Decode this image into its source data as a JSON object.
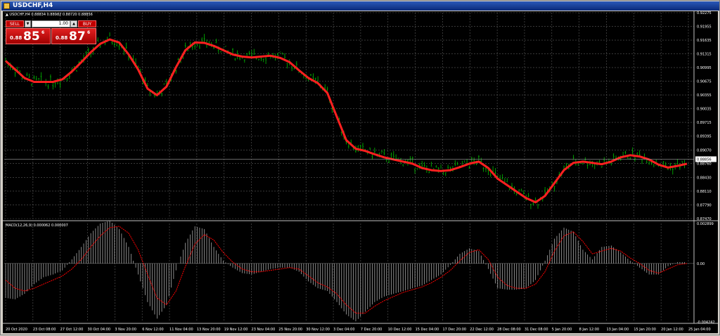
{
  "window": {
    "title": "USDCHF,H4"
  },
  "chart_header": {
    "text": "▲ USDCHF,H4  0.88834 0.88982 0.88720 0.88856"
  },
  "trade_panel": {
    "sell_label": "SELL",
    "buy_label": "BUY",
    "lot_value": "1.00",
    "sell_small": "0.88",
    "sell_big": "85",
    "sell_sup": "6",
    "buy_small": "0.88",
    "buy_big": "87",
    "buy_sup": "6"
  },
  "colors": {
    "background": "#000000",
    "grid": "#5a5a5a",
    "candles": "#00c000",
    "moving_average": "#ff2020",
    "histogram": "#c0c0c0",
    "signal": "#ff0000",
    "axis_text": "#ffffff",
    "trade_button": "#c00000"
  },
  "macd_header": {
    "text": "MACD(12,26,9) 0.000062 0.000007"
  },
  "chart_data": [
    {
      "type": "candlestick",
      "symbol": "USDCHF",
      "timeframe": "H4",
      "y_ticks": [
        "0.92275",
        "0.91955",
        "0.91635",
        "0.91315",
        "0.90995",
        "0.90675",
        "0.90355",
        "0.90035",
        "0.89715",
        "0.89395",
        "0.89070",
        "0.88760",
        "0.88430",
        "0.88110",
        "0.87790",
        "0.87470"
      ],
      "ylim": [
        0.8747,
        0.92275
      ],
      "current_price_label": "0.88856",
      "current_price": 0.88856,
      "moving_average_close": [
        0.9115,
        0.9095,
        0.9075,
        0.9066,
        0.9066,
        0.9066,
        0.9072,
        0.909,
        0.9112,
        0.9135,
        0.9155,
        0.9165,
        0.9158,
        0.913,
        0.9095,
        0.905,
        0.9035,
        0.9055,
        0.91,
        0.914,
        0.9158,
        0.9157,
        0.915,
        0.914,
        0.913,
        0.9125,
        0.9123,
        0.9125,
        0.9127,
        0.9122,
        0.9112,
        0.9093,
        0.9075,
        0.9063,
        0.904,
        0.8985,
        0.893,
        0.891,
        0.8905,
        0.8897,
        0.889,
        0.8885,
        0.888,
        0.8875,
        0.8865,
        0.886,
        0.8858,
        0.886,
        0.8867,
        0.8875,
        0.888,
        0.8865,
        0.884,
        0.8825,
        0.881,
        0.8795,
        0.8785,
        0.88,
        0.883,
        0.886,
        0.8877,
        0.888,
        0.8877,
        0.8874,
        0.888,
        0.889,
        0.8895,
        0.8892,
        0.8885,
        0.8873,
        0.8866,
        0.887,
        0.8875
      ]
    },
    {
      "type": "bar",
      "name": "MACD(12,26,9)",
      "y_ticks": [
        "0.002899",
        "0.00",
        "-0.004242"
      ],
      "ylim": [
        -0.004242,
        0.002899
      ],
      "histogram": [
        -0.0025,
        -0.0026,
        -0.0022,
        -0.0015,
        -0.001,
        -0.0008,
        -0.0005,
        0.0003,
        0.0012,
        0.0022,
        0.0029,
        0.0031,
        0.0025,
        0.0012,
        -0.0008,
        -0.0028,
        -0.004,
        -0.003,
        -0.0005,
        0.0015,
        0.0027,
        0.0025,
        0.0012,
        0.0002,
        -0.0003,
        -0.0007,
        -0.0008,
        -0.0006,
        -0.0004,
        -0.0003,
        -0.0003,
        -0.0006,
        -0.0013,
        -0.0018,
        -0.002,
        -0.0028,
        -0.0037,
        -0.0042,
        -0.0035,
        -0.0028,
        -0.0024,
        -0.0022,
        -0.002,
        -0.0018,
        -0.0016,
        -0.0012,
        -0.0008,
        -0.0001,
        0.0007,
        0.0011,
        0.0009,
        -0.0004,
        -0.0018,
        -0.0019,
        -0.0019,
        -0.0018,
        -0.0012,
        0.0002,
        0.0018,
        0.0026,
        0.0023,
        0.001,
        0.0003,
        0.0012,
        0.0013,
        0.0008,
        0.0002,
        -0.0003,
        -0.0008,
        -0.0008,
        -0.0002,
        0.0001,
        0.0001
      ],
      "signal": [
        -0.0012,
        -0.0018,
        -0.002,
        -0.0018,
        -0.0015,
        -0.0012,
        -0.0009,
        -0.0004,
        0.0003,
        0.0012,
        0.002,
        0.0026,
        0.0027,
        0.0022,
        0.001,
        -0.0008,
        -0.0025,
        -0.003,
        -0.002,
        -0.0002,
        0.0014,
        0.0021,
        0.0017,
        0.0008,
        0.0001,
        -0.0004,
        -0.0006,
        -0.0006,
        -0.0005,
        -0.0004,
        -0.0003,
        -0.0004,
        -0.0009,
        -0.0014,
        -0.0017,
        -0.0022,
        -0.003,
        -0.0036,
        -0.0036,
        -0.0031,
        -0.0027,
        -0.0024,
        -0.0021,
        -0.0019,
        -0.0017,
        -0.0014,
        -0.001,
        -0.0005,
        0.0002,
        0.0008,
        0.001,
        0.0003,
        -0.001,
        -0.0016,
        -0.0018,
        -0.0018,
        -0.0015,
        -0.0006,
        0.0009,
        0.002,
        0.0023,
        0.0016,
        0.0007,
        0.0009,
        0.0011,
        0.0009,
        0.0004,
        0.0,
        -0.0005,
        -0.0007,
        -0.0004,
        -0.0001,
        0.0
      ]
    }
  ],
  "x_ticks": [
    "20 Oct 2020",
    "23 Oct 08:00",
    "27 Oct 12:00",
    "30 Oct 04:00",
    "3 Nov 20:00",
    "6 Nov 12:00",
    "11 Nov 04:00",
    "13 Nov 20:00",
    "19 Nov 12:00",
    "23 Nov 04:00",
    "25 Nov 20:00",
    "30 Nov 12:00",
    "3 Dec 04:00",
    "7 Dec 20:00",
    "10 Dec 12:00",
    "15 Dec 04:00",
    "17 Dec 20:00",
    "22 Dec 12:00",
    "28 Dec 08:00",
    "31 Dec 08:00",
    "5 Jan 20:00",
    "8 Jan 12:00",
    "13 Jan 04:00",
    "15 Jan 20:00",
    "20 Jan 12:00",
    "25 Jan 04:00"
  ]
}
